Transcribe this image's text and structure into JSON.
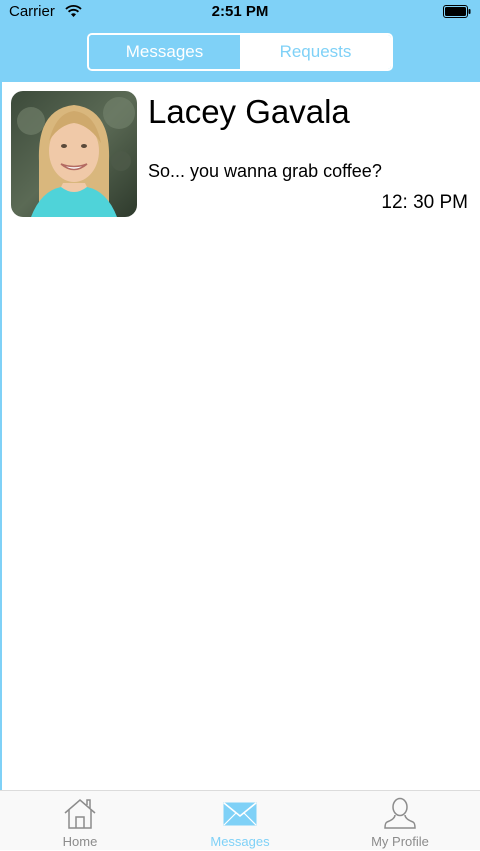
{
  "status_bar": {
    "carrier": "Carrier",
    "time": "2:51 PM",
    "wifi_icon": "wifi-icon",
    "battery_icon": "battery-icon"
  },
  "segmented_control": {
    "selected": "Messages",
    "segments": [
      {
        "label": "Messages",
        "active": true
      },
      {
        "label": "Requests",
        "active": false
      }
    ]
  },
  "conversations": [
    {
      "name": "Lacey Gavala",
      "preview": "So... you wanna grab coffee?",
      "time": "12: 30 PM",
      "avatar_icon": "contact-photo"
    }
  ],
  "tab_bar": {
    "items": [
      {
        "label": "Home",
        "icon": "home-icon",
        "active": false
      },
      {
        "label": "Messages",
        "icon": "envelope-icon",
        "active": true
      },
      {
        "label": "My Profile",
        "icon": "person-icon",
        "active": false
      }
    ]
  },
  "colors": {
    "accent": "#7fd1f7",
    "inactive_tab": "#8c8c8c",
    "background": "#ffffff"
  }
}
